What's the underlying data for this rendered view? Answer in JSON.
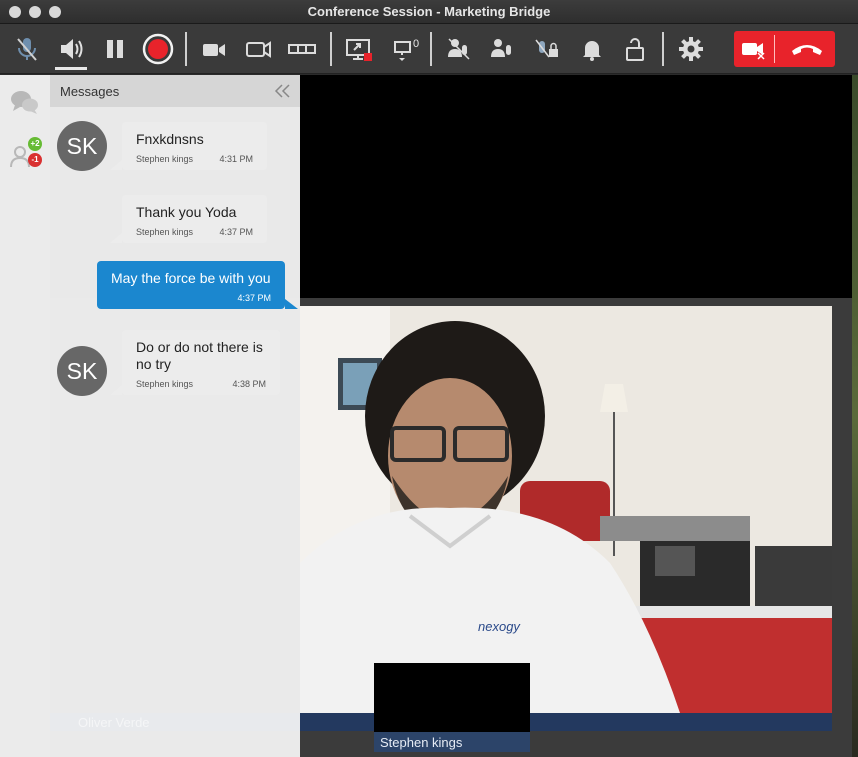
{
  "window": {
    "title": "Conference Session - Marketing Bridge"
  },
  "toolbar": {
    "buttons": [
      {
        "name": "mute-microphone",
        "icon": "microphone-muted-icon"
      },
      {
        "name": "speaker",
        "icon": "speaker-icon"
      },
      {
        "name": "pause",
        "icon": "pause-icon"
      },
      {
        "name": "record",
        "icon": "record-icon"
      },
      {
        "name": "video-layout",
        "icon": "video-layout-icon"
      },
      {
        "name": "camera",
        "icon": "video-camera-icon"
      },
      {
        "name": "filmstrip",
        "icon": "filmstrip-icon"
      },
      {
        "name": "share-screen",
        "icon": "screen-share-icon"
      },
      {
        "name": "displays",
        "icon": "monitor-icon"
      },
      {
        "name": "mute-all",
        "icon": "participants-muted-icon"
      },
      {
        "name": "participant-mic",
        "icon": "participant-mic-icon"
      },
      {
        "name": "lock-mic",
        "icon": "mic-lock-icon"
      },
      {
        "name": "notifications",
        "icon": "bell-icon"
      },
      {
        "name": "lock",
        "icon": "unlocked-icon"
      },
      {
        "name": "settings",
        "icon": "gear-icon"
      },
      {
        "name": "stop-video",
        "icon": "video-off-icon"
      },
      {
        "name": "hang-up",
        "icon": "phone-hangup-icon"
      }
    ],
    "display_count": "0"
  },
  "rail": {
    "participants_joined": "+2",
    "participants_left": "-1"
  },
  "messages": {
    "title": "Messages",
    "items": [
      {
        "type": "in",
        "initials": "SK",
        "text": "Fnxkdnsns",
        "sender": "Stephen kings",
        "time": "4:31 PM"
      },
      {
        "type": "in",
        "initials": "",
        "text": "Thank you Yoda",
        "sender": "Stephen kings",
        "time": "4:37 PM"
      },
      {
        "type": "out",
        "text": "May the force be with you",
        "time": "4:37 PM"
      },
      {
        "type": "in",
        "initials": "SK",
        "text": "Do or do not there is no try",
        "sender": "Stephen kings",
        "time": "4:38 PM"
      }
    ]
  },
  "video": {
    "main_participant": "Oliver Verde",
    "thumbnail_participant": "Stephen kings",
    "shirt_logo": "nexogy"
  },
  "colors": {
    "accent_blue": "#1b87cf",
    "end_call_red": "#e8232b",
    "record_red": "#e8232b",
    "badge_green": "#66bb33",
    "badge_red": "#d93030"
  }
}
